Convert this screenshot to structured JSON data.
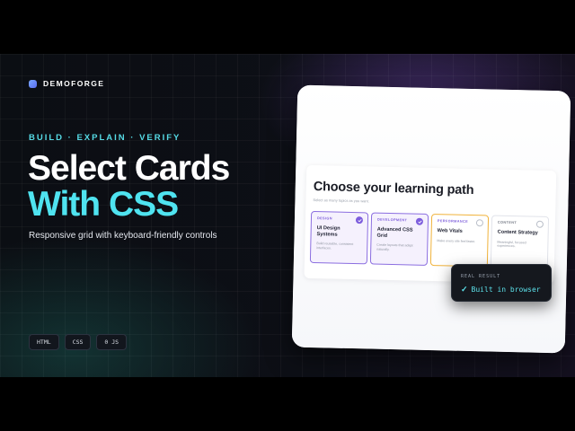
{
  "brand": {
    "name": "DEMOFORGE"
  },
  "hero": {
    "kicker": "BUILD · EXPLAIN · VERIFY",
    "title_line1": "Select Cards",
    "title_line2": "With CSS",
    "subtitle": "Responsive grid with keyboard-friendly controls"
  },
  "tags": [
    "HTML",
    "CSS",
    "0 JS"
  ],
  "preview": {
    "title": "Choose your learning path",
    "hint": "Select as many topics as you want.",
    "cards": [
      {
        "category": "DESIGN",
        "name": "UI Design Systems",
        "description": "Build reusable, consistent interfaces.",
        "selected": true
      },
      {
        "category": "DEVELOPMENT",
        "name": "Advanced CSS Grid",
        "description": "Create layouts that adapt naturally.",
        "selected": true
      },
      {
        "category": "PERFORMANCE",
        "name": "Web Vitals",
        "description": "Make every site feel faster.",
        "selected": false,
        "focused": true
      },
      {
        "category": "CONTENT",
        "name": "Content Strategy",
        "description": "Meaningful, focused experiences.",
        "selected": false
      }
    ]
  },
  "result": {
    "label": "REAL RESULT",
    "check": "✓",
    "text": "Built in browser"
  },
  "colors": {
    "accent": "#4fe3f0",
    "selected_border": "#8b6ee0",
    "focus_border": "#f0b23a",
    "check": "#7d5ddd"
  }
}
